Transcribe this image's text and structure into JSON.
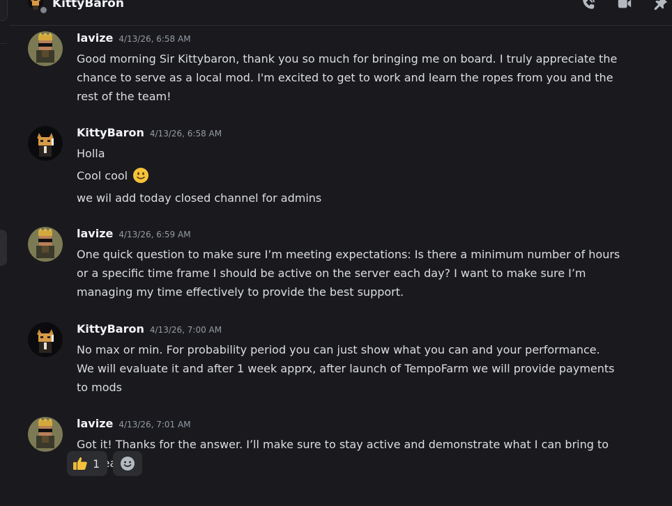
{
  "header": {
    "title": "KittyBaron",
    "icons": [
      "voice-call-icon",
      "video-call-icon",
      "pinned-messages-icon"
    ]
  },
  "messages": [
    {
      "username": "lavize",
      "timestamp": "4/13/26, 6:58 AM",
      "lines": [
        "Good morning Sir Kittybaron, thank you so much for bringing me on board. I truly appreciate the",
        "chance to serve as a local mod. I'm excited to get to work and learn the ropes from you and the",
        "rest of the team!"
      ]
    },
    {
      "username": "KittyBaron",
      "timestamp": "4/13/26, 6:58 AM",
      "lines": [
        "Holla",
        "Cool cool",
        "we wil add today closed channel for admins"
      ],
      "emoji": "slightly-smiling-face"
    },
    {
      "username": "lavize",
      "timestamp": "4/13/26, 6:59 AM",
      "lines": [
        "One quick question to make sure I’m meeting expectations: Is there a minimum number of hours",
        "or a specific time frame I should be active on the server each day? I want to make sure I’m",
        "managing my time effectively to provide the best support."
      ]
    },
    {
      "username": "KittyBaron",
      "timestamp": "4/13/26, 7:00 AM",
      "lines": [
        "No max or min. For probability period you can just show what you can and your performance.",
        "We will evaluate it and after 1 week apprx, after launch of TempoFarm we will  provide payments",
        "to mods"
      ]
    },
    {
      "username": "lavize",
      "timestamp": "4/13/26, 7:01 AM",
      "lines": [
        "Got it! Thanks for the answer. I’ll make sure to stay active and demonstrate what I can bring to",
        "the team."
      ]
    }
  ],
  "reactions": [
    {
      "emoji": "thumbs-up",
      "count": "1"
    },
    {
      "emoji": "add-reaction"
    }
  ],
  "colors": {
    "background": "#1a1a1e",
    "username": "#f2f3f5",
    "text": "#dbdee1",
    "timestamp": "#949ba4",
    "reaction_bg": "#2b2d31"
  }
}
